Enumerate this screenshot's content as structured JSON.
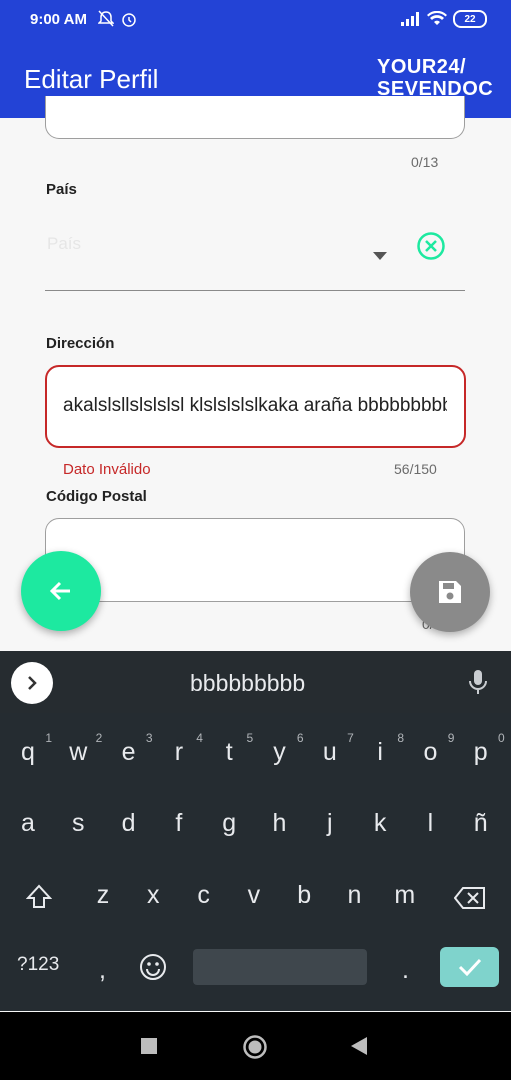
{
  "status_bar": {
    "time": "9:00 AM",
    "battery": "22"
  },
  "app_bar": {
    "title": "Editar Perfil",
    "logo_line1": "YOUR24/",
    "logo_line2": "SEVENDOC"
  },
  "form": {
    "top_counter": "0/13",
    "pais_label": "País",
    "pais_placeholder": "País",
    "direccion_label": "Dirección",
    "direccion_value": "akalslsllslslslsl klslslslslkaka araña bbbbbbbbb",
    "direccion_error": "Dato Inválido",
    "direccion_counter": "56/150",
    "codigo_postal_label": "Código Postal",
    "bottom_counter": "0/"
  },
  "keyboard": {
    "suggestion": "bbbbbbbbb",
    "row1": [
      {
        "k": "q",
        "n": "1"
      },
      {
        "k": "w",
        "n": "2"
      },
      {
        "k": "e",
        "n": "3"
      },
      {
        "k": "r",
        "n": "4"
      },
      {
        "k": "t",
        "n": "5"
      },
      {
        "k": "y",
        "n": "6"
      },
      {
        "k": "u",
        "n": "7"
      },
      {
        "k": "i",
        "n": "8"
      },
      {
        "k": "o",
        "n": "9"
      },
      {
        "k": "p",
        "n": "0"
      }
    ],
    "row2": [
      "a",
      "s",
      "d",
      "f",
      "g",
      "h",
      "j",
      "k",
      "l",
      "ñ"
    ],
    "row3": [
      "z",
      "x",
      "c",
      "v",
      "b",
      "n",
      "m"
    ],
    "symbols": "?123",
    "comma": ",",
    "period": "."
  },
  "colors": {
    "primary": "#2343d6",
    "error": "#c62828",
    "fab_back": "#1de9a0",
    "fab_save": "#8a8a8a",
    "confirm_key": "#7fd3cc"
  }
}
